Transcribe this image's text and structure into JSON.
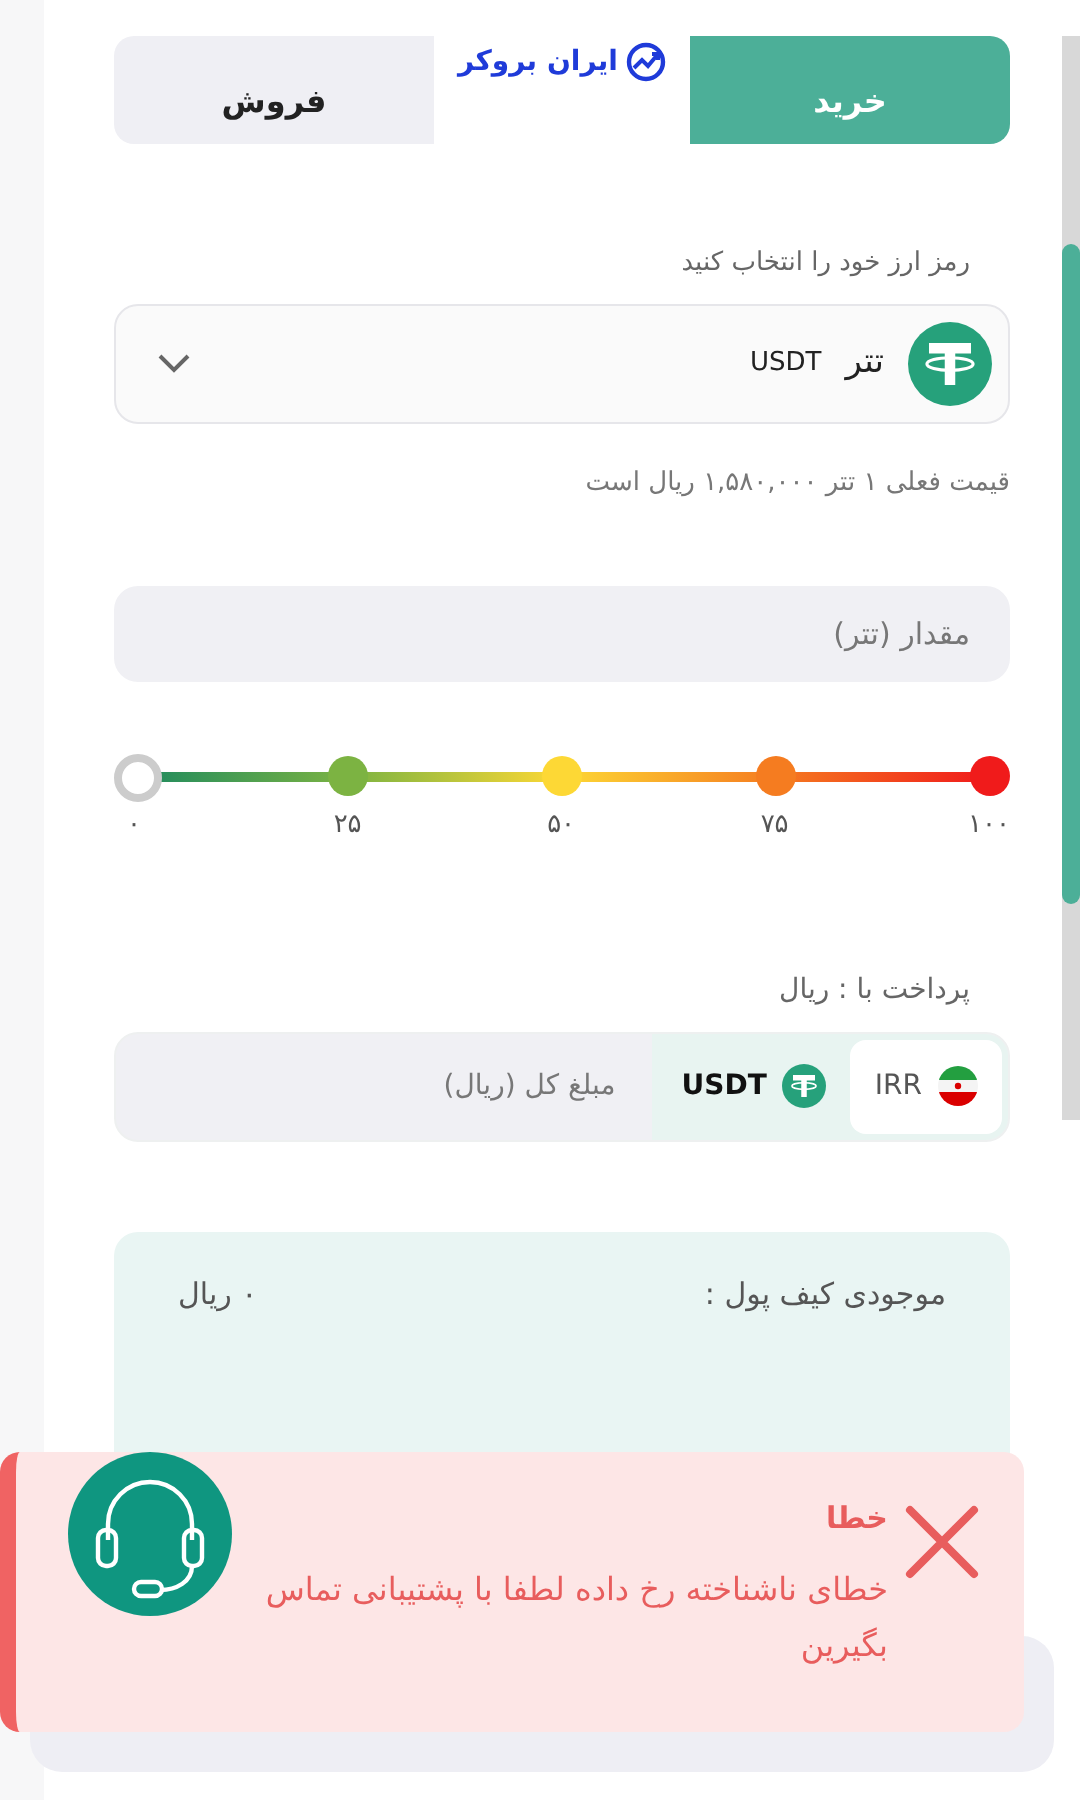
{
  "logo": {
    "text": "ایران بروکر"
  },
  "tabs": [
    {
      "label": "خرید",
      "selected": true
    },
    {
      "label": "فروش",
      "selected": false
    }
  ],
  "coin_select": {
    "label": "رمز ارز خود را انتخاب کنید",
    "name": "تتر",
    "symbol": "USDT"
  },
  "price_note": "قیمت فعلی ۱ تتر ۱,۵۸۰,۰۰۰ ریال است",
  "amount_field": {
    "placeholder": "مقدار (تتر)"
  },
  "slider": {
    "level": 0,
    "ticks": [
      {
        "label": "۱۰۰",
        "color": "#f01b1b"
      },
      {
        "label": "۷۵",
        "color": "#f57c20"
      },
      {
        "label": "۵۰",
        "color": "#fdd835"
      },
      {
        "label": "۲۵",
        "color": "#7cb342"
      },
      {
        "label": "۰",
        "color": "#cccccc"
      }
    ]
  },
  "payment": {
    "label": "پرداخت با : ریال",
    "currencies": [
      {
        "code": "IRR",
        "kind": "flag",
        "selected": true
      },
      {
        "code": "USDT",
        "kind": "tether",
        "selected": false
      }
    ],
    "placeholder": "مبلغ کل (ریال)"
  },
  "info": [
    {
      "label": "موجودی کیف پول :",
      "value": "۰ ریال"
    }
  ],
  "toast": {
    "title": "خطا",
    "message": "خطای ناشناخته رخ داده لطفا با پشتیبانی تماس بگیرین"
  }
}
